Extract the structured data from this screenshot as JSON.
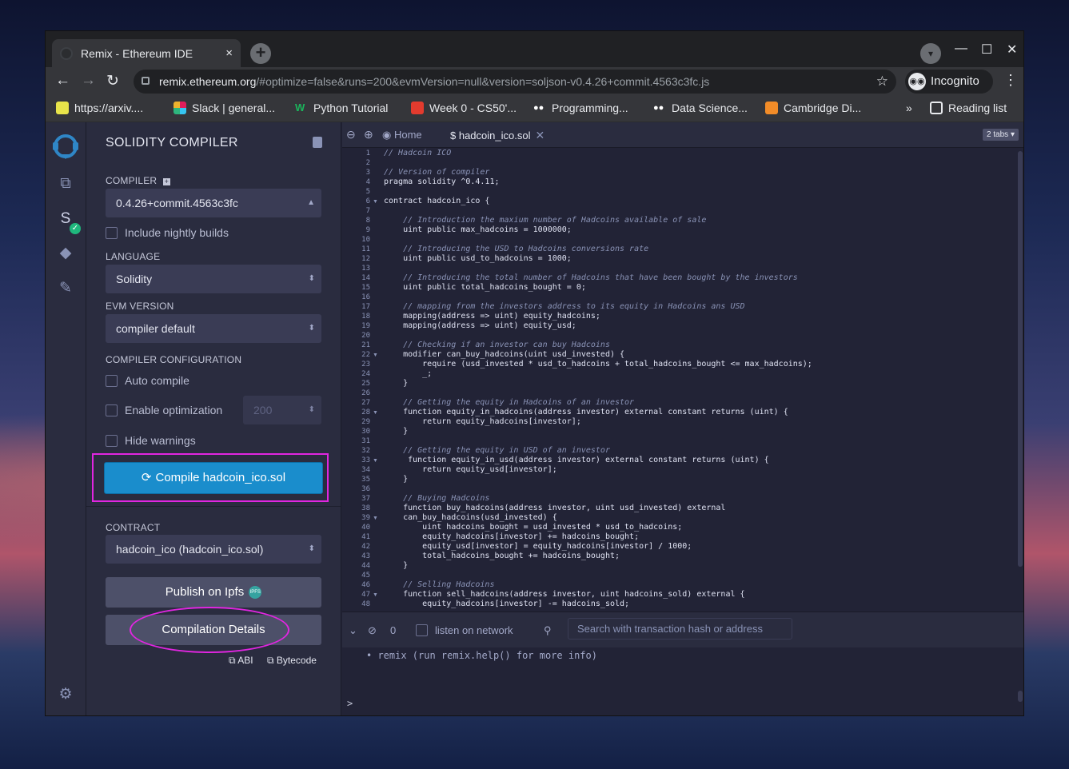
{
  "browser": {
    "tab_title": "Remix - Ethereum IDE",
    "tab_close": "×",
    "new_tab": "+",
    "url_domain": "remix.ethereum.org",
    "url_rest": "/#optimize=false&runs=200&evmVersion=null&version=soljson-v0.4.26+commit.4563c3fc.js",
    "profile_label": "Incognito",
    "bookmarks": [
      {
        "label": "https://arxiv....",
        "color": "#e8e44a"
      },
      {
        "label": "Slack | general...",
        "color": "#e01e5a"
      },
      {
        "label": "Python Tutorial",
        "color": "#1bb55c"
      },
      {
        "label": "Week 0 - CS50'...",
        "color": "#e33b2e"
      },
      {
        "label": "Programming...",
        "color": "#ffffff"
      },
      {
        "label": "Data Science...",
        "color": "#ffffff"
      },
      {
        "label": "Cambridge Di...",
        "color": "#f28c28"
      }
    ],
    "more_bookmarks": "»",
    "reading_list": "Reading list"
  },
  "sidebar": {
    "title": "SOLIDITY COMPILER",
    "compiler_label": "COMPILER",
    "compiler_value": "0.4.26+commit.4563c3fc",
    "include_nightly": "Include nightly builds",
    "language_label": "LANGUAGE",
    "language_value": "Solidity",
    "evm_label": "EVM VERSION",
    "evm_value": "compiler default",
    "config_label": "COMPILER CONFIGURATION",
    "auto_compile": "Auto compile",
    "enable_optimization": "Enable optimization",
    "runs_value": "200",
    "hide_warnings": "Hide warnings",
    "compile_button": "Compile hadcoin_ico.sol",
    "contract_label": "CONTRACT",
    "contract_value": "hadcoin_ico (hadcoin_ico.sol)",
    "publish_button": "Publish on Ipfs",
    "ipfs_badge": "IPFS",
    "details_button": "Compilation Details",
    "abi_label": "ABI",
    "bytecode_label": "Bytecode"
  },
  "editor": {
    "tab_home": "Home",
    "tab_file": "hadcoin_ico.sol",
    "tabs_count": "2 tabs",
    "code_lines": [
      {
        "n": "1",
        "t": "// Hadcoin ICO",
        "c": true
      },
      {
        "n": "2",
        "t": "",
        "c": false
      },
      {
        "n": "3",
        "t": "// Version of compiler",
        "c": true
      },
      {
        "n": "4",
        "t": "pragma solidity ^0.4.11;",
        "c": false
      },
      {
        "n": "5",
        "t": "",
        "c": false
      },
      {
        "n": "6",
        "t": "contract hadcoin_ico {",
        "c": false,
        "f": true
      },
      {
        "n": "7",
        "t": "",
        "c": false
      },
      {
        "n": "8",
        "t": "    // Introduction the maxium number of Hadcoins available of sale",
        "c": true
      },
      {
        "n": "9",
        "t": "    uint public max_hadcoins = 1000000;",
        "c": false
      },
      {
        "n": "10",
        "t": "",
        "c": false
      },
      {
        "n": "11",
        "t": "    // Introducing the USD to Hadcoins conversions rate",
        "c": true
      },
      {
        "n": "12",
        "t": "    uint public usd_to_hadcoins = 1000;",
        "c": false
      },
      {
        "n": "13",
        "t": "",
        "c": false
      },
      {
        "n": "14",
        "t": "    // Introducing the total number of Hadcoins that have been bought by the investors",
        "c": true
      },
      {
        "n": "15",
        "t": "    uint public total_hadcoins_bought = 0;",
        "c": false
      },
      {
        "n": "16",
        "t": "",
        "c": false
      },
      {
        "n": "17",
        "t": "    // mapping from the investors address to its equity in Hadcoins ans USD",
        "c": true
      },
      {
        "n": "18",
        "t": "    mapping(address => uint) equity_hadcoins;",
        "c": false
      },
      {
        "n": "19",
        "t": "    mapping(address => uint) equity_usd;",
        "c": false
      },
      {
        "n": "20",
        "t": "",
        "c": false
      },
      {
        "n": "21",
        "t": "    // Checking if an investor can buy Hadcoins",
        "c": true
      },
      {
        "n": "22",
        "t": "    modifier can_buy_hadcoins(uint usd_invested) {",
        "c": false,
        "f": true
      },
      {
        "n": "23",
        "t": "        require (usd_invested * usd_to_hadcoins + total_hadcoins_bought <= max_hadcoins);",
        "c": false
      },
      {
        "n": "24",
        "t": "        _;",
        "c": false
      },
      {
        "n": "25",
        "t": "    }",
        "c": false
      },
      {
        "n": "26",
        "t": "",
        "c": false
      },
      {
        "n": "27",
        "t": "    // Getting the equity in Hadcoins of an investor",
        "c": true
      },
      {
        "n": "28",
        "t": "    function equity_in_hadcoins(address investor) external constant returns (uint) {",
        "c": false,
        "f": true
      },
      {
        "n": "29",
        "t": "        return equity_hadcoins[investor];",
        "c": false
      },
      {
        "n": "30",
        "t": "    }",
        "c": false
      },
      {
        "n": "31",
        "t": "",
        "c": false
      },
      {
        "n": "32",
        "t": "    // Getting the equity in USD of an investor",
        "c": true
      },
      {
        "n": "33",
        "t": "     function equity_in_usd(address investor) external constant returns (uint) {",
        "c": false,
        "f": true
      },
      {
        "n": "34",
        "t": "        return equity_usd[investor];",
        "c": false
      },
      {
        "n": "35",
        "t": "    }",
        "c": false
      },
      {
        "n": "36",
        "t": "",
        "c": false
      },
      {
        "n": "37",
        "t": "    // Buying Hadcoins",
        "c": true
      },
      {
        "n": "38",
        "t": "    function buy_hadcoins(address investor, uint usd_invested) external",
        "c": false
      },
      {
        "n": "39",
        "t": "    can_buy_hadcoins(usd_invested) {",
        "c": false,
        "f": true
      },
      {
        "n": "40",
        "t": "        uint hadcoins_bought = usd_invested * usd_to_hadcoins;",
        "c": false
      },
      {
        "n": "41",
        "t": "        equity_hadcoins[investor] += hadcoins_bought;",
        "c": false
      },
      {
        "n": "42",
        "t": "        equity_usd[investor] = equity_hadcoins[investor] / 1000;",
        "c": false
      },
      {
        "n": "43",
        "t": "        total_hadcoins_bought += hadcoins_bought;",
        "c": false
      },
      {
        "n": "44",
        "t": "    }",
        "c": false
      },
      {
        "n": "45",
        "t": "",
        "c": false
      },
      {
        "n": "46",
        "t": "    // Selling Hadcoins",
        "c": true
      },
      {
        "n": "47",
        "t": "    function sell_hadcoins(address investor, uint hadcoins_sold) external {",
        "c": false,
        "f": true
      },
      {
        "n": "48",
        "t": "        equity_hadcoins[investor] -= hadcoins_sold;",
        "c": false
      }
    ]
  },
  "terminal": {
    "count": "0",
    "listen_label": "listen on network",
    "search_placeholder": "Search with transaction hash or address",
    "help_line": "• remix (run remix.help() for more info)",
    "prompt": ">"
  }
}
